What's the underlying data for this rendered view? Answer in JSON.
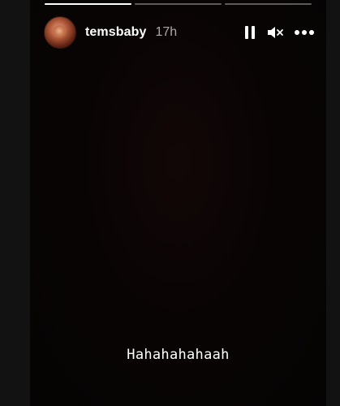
{
  "story": {
    "progress": [
      1.0,
      0.0,
      0.0
    ],
    "user": {
      "username": "temsbaby",
      "time": "17h"
    },
    "controls": {
      "pause_icon": "pause-icon",
      "mute_icon": "speaker-muted-icon",
      "more_icon": "more-icon"
    },
    "caption": "Hahahahahaah"
  }
}
